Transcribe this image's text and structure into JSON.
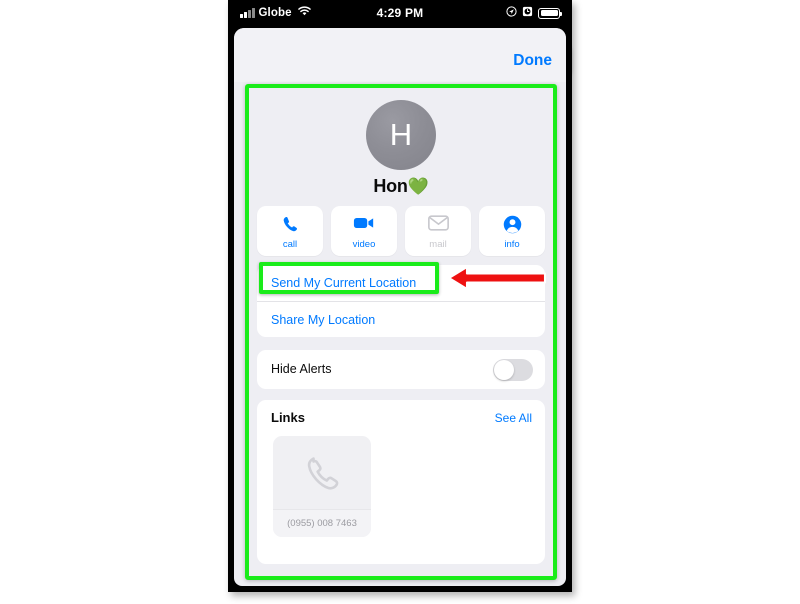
{
  "status_bar": {
    "carrier": "Globe",
    "time": "4:29 PM",
    "signal_icon": "cellular-signal-icon",
    "wifi_icon": "wifi-icon",
    "location_icon": "location-arrow-icon",
    "alarm_icon": "alarm-clock-icon",
    "battery_icon": "battery-icon"
  },
  "navbar": {
    "done_label": "Done"
  },
  "profile": {
    "avatar_initial": "H",
    "name": "Hon",
    "name_emoji": "💚",
    "avatar_name": "contact-avatar"
  },
  "actions": [
    {
      "label": "call",
      "icon": "phone-icon",
      "enabled": true
    },
    {
      "label": "video",
      "icon": "video-camera-icon",
      "enabled": true
    },
    {
      "label": "mail",
      "icon": "envelope-icon",
      "enabled": false
    },
    {
      "label": "info",
      "icon": "person-circle-icon",
      "enabled": true
    }
  ],
  "location": {
    "send_current": "Send My Current Location",
    "share": "Share My Location"
  },
  "alerts": {
    "label": "Hide Alerts",
    "toggle_state": "off"
  },
  "links": {
    "title": "Links",
    "see_all": "See All",
    "items": [
      {
        "caption": "(0955) 008 7463",
        "icon": "phone-handset-icon"
      }
    ]
  },
  "annotations": {
    "highlight_color": "#1aec1a",
    "arrow_color": "#ee1111",
    "arrow_direction": "left",
    "highlighted_target": "Send My Current Location"
  },
  "colors": {
    "accent_blue": "#007aff",
    "background": "#eeeef3",
    "card": "#ffffff",
    "heart_green": "#5ad74e"
  }
}
